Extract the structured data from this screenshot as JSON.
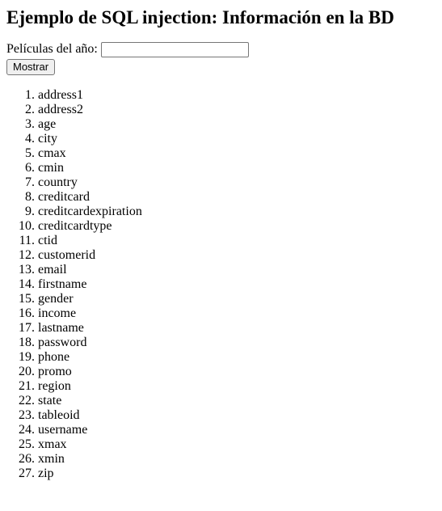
{
  "page": {
    "heading": "Ejemplo de SQL injection: Información en la BD"
  },
  "form": {
    "year_label": "Películas del año:",
    "year_value": "",
    "year_placeholder": "",
    "submit_label": "Mostrar"
  },
  "columns": [
    "address1",
    "address2",
    "age",
    "city",
    "cmax",
    "cmin",
    "country",
    "creditcard",
    "creditcardexpiration",
    "creditcardtype",
    "ctid",
    "customerid",
    "email",
    "firstname",
    "gender",
    "income",
    "lastname",
    "password",
    "phone",
    "promo",
    "region",
    "state",
    "tableoid",
    "username",
    "xmax",
    "xmin",
    "zip"
  ]
}
